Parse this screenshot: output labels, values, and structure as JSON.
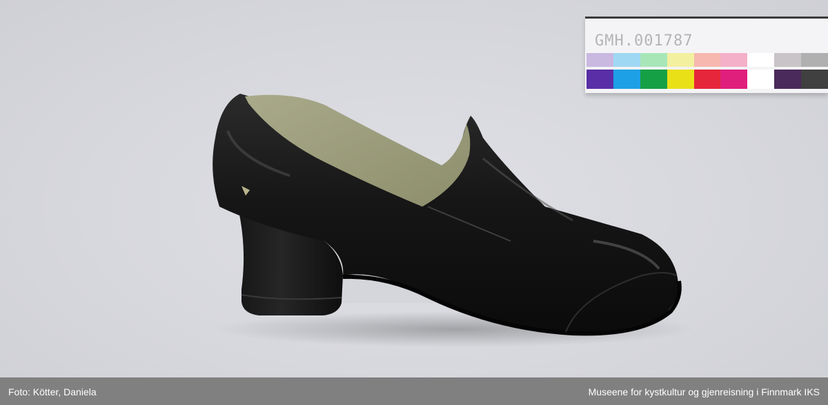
{
  "card": {
    "accession_number": "GMH.001787",
    "swatch_colors": [
      [
        "#c9b8e0",
        "#5a2ea6"
      ],
      [
        "#9fd8f3",
        "#1ea0e6"
      ],
      [
        "#a8e6b8",
        "#16a046"
      ],
      [
        "#f3f0a0",
        "#eae018"
      ],
      [
        "#f7b8b0",
        "#e6263a"
      ],
      [
        "#f4b0c8",
        "#e01e7c"
      ],
      [
        "#ffffff",
        "#ffffff"
      ],
      [
        "#c8c4c8",
        "#4a2a5a"
      ],
      [
        "#b0b0b0",
        "#404040"
      ]
    ]
  },
  "caption": {
    "photo_credit": "Foto: Kötter, Daniela",
    "institution": "Museene for kystkultur og gjenreisning i Finnmark IKS"
  },
  "colors": {
    "caption_bar": "#808080",
    "shoe": "#151515",
    "lining": "#9e9f7c"
  }
}
